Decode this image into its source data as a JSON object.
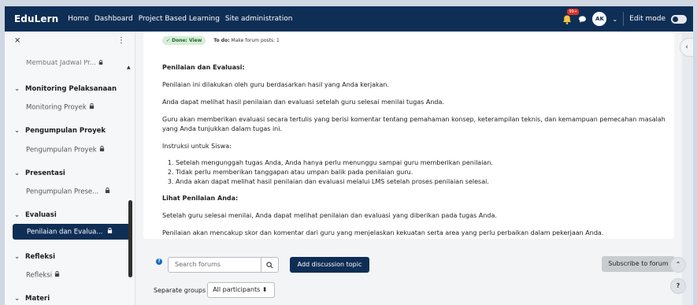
{
  "topbar": {
    "brand": "EduLern",
    "nav": [
      "Home",
      "Dashboard",
      "Project Based Learning",
      "Site administration"
    ],
    "notif_badge": "99+",
    "avatar": "AK",
    "edit_mode": "Edit mode",
    "colors": {
      "bar": "#0f2e55"
    }
  },
  "sidebar": {
    "close": "×",
    "more": "⋮",
    "truncated_top": "Membuat Jadwal Pr...",
    "sections": [
      {
        "title": "Monitoring Pelaksanaan",
        "items": [
          {
            "label": "Monitoring Proyek",
            "locked": true
          }
        ]
      },
      {
        "title": "Pengumpulan Proyek",
        "items": [
          {
            "label": "Pengumpulan Proyek",
            "locked": true
          }
        ]
      },
      {
        "title": "Presentasi",
        "items": [
          {
            "label": "Pengumpulan Prese...",
            "locked": true
          }
        ]
      },
      {
        "title": "Evaluasi",
        "items": [
          {
            "label": "Penilaian dan Evalua...",
            "locked": true,
            "active": true
          }
        ]
      },
      {
        "title": "Refleksi",
        "items": [
          {
            "label": "Refleksi",
            "locked": true
          }
        ]
      },
      {
        "title": "Materi",
        "items": []
      }
    ]
  },
  "status": {
    "done": "✓ Done: View",
    "todo_label": "To do:",
    "todo_text": "Make forum posts: 1"
  },
  "content": {
    "heading1": "Penilaian dan Evaluasi:",
    "p1": "Penilaian ini dilakukan oleh guru berdasarkan hasil yang Anda kerjakan.",
    "p2": "Anda dapat melihat hasil penilaian dan evaluasi setelah guru selesai menilai tugas Anda.",
    "p3": "Guru akan memberikan evaluasi secara tertulis yang berisi komentar tentang pemahaman konsep, keterampilan teknis, dan kemampuan pemecahan masalah yang Anda tunjukkan dalam tugas ini.",
    "instr_title": "Instruksi untuk Siswa:",
    "list": [
      "Setelah mengunggah tugas Anda, Anda hanya perlu menunggu sampai guru memberikan penilaian.",
      "Tidak perlu memberikan tanggapan atau umpan balik pada penilaian guru.",
      "Anda akan dapat melihat hasil penilaian dan evaluasi melalui LMS setelah proses penilaian selesai."
    ],
    "heading2": "Lihat Penilaian Anda:",
    "p4": "Setelah guru selesai menilai, Anda dapat melihat penilaian dan evaluasi yang diberikan pada tugas Anda.",
    "p5": "Penilaian akan mencakup skor dan komentar dari guru yang menjelaskan kekuatan serta area yang perlu perbaikan dalam pekerjaan Anda."
  },
  "forum": {
    "help": "?",
    "search_placeholder": "Search forums",
    "add_topic": "Add discussion topic",
    "subscribe": "Subscribe to forum",
    "separate_groups": "Separate groups",
    "group_select": "All participants ⬍"
  },
  "floating": {
    "drawer": "‹",
    "up": "⌃",
    "help": "?"
  }
}
